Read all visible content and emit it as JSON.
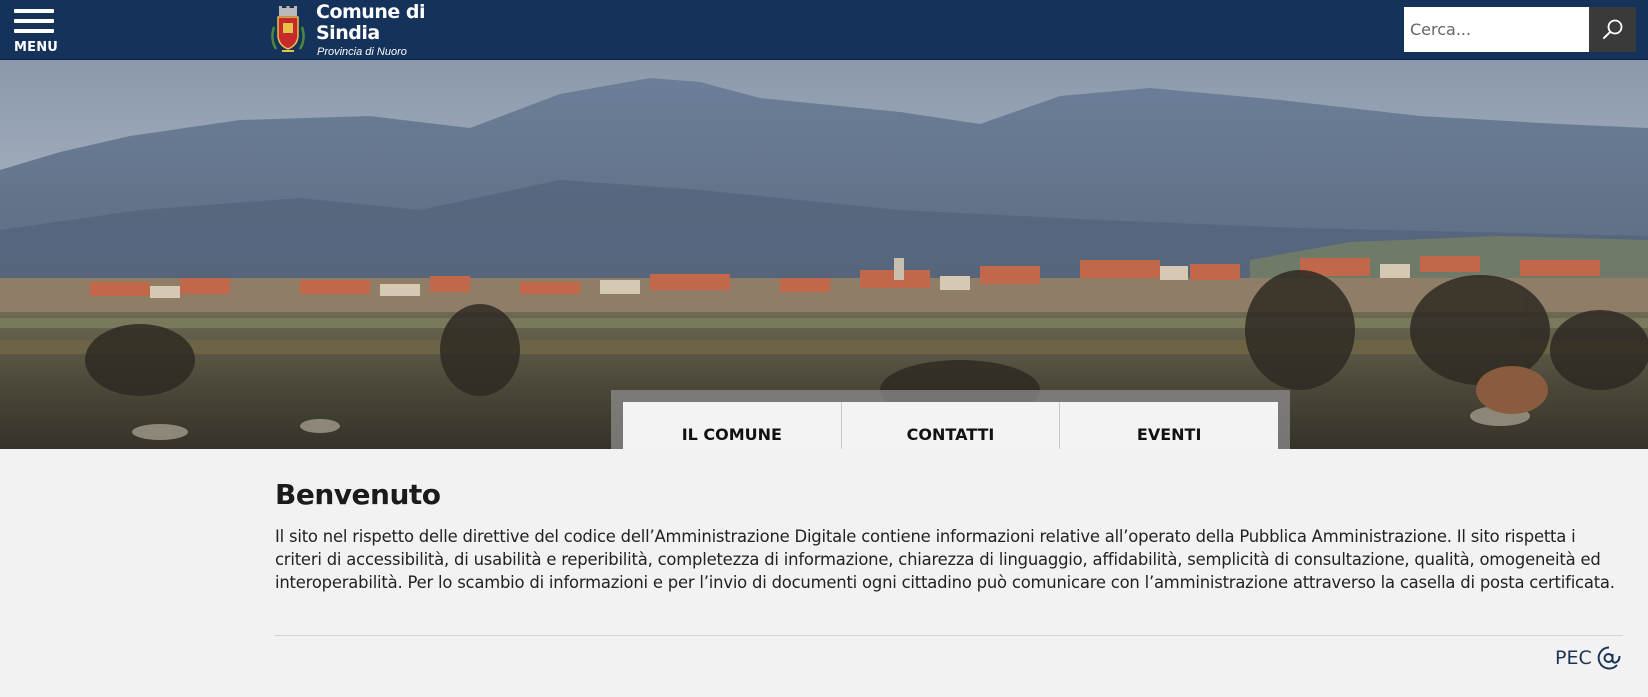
{
  "header": {
    "menu_label": "MENU",
    "site_title_line1": "Comune di",
    "site_title_line2": "Sindia",
    "site_subtitle": "Provincia di Nuoro",
    "search_placeholder": "Cerca...",
    "colors": {
      "background": "#14325a",
      "search_button": "#3a3a3a"
    }
  },
  "quick_links": [
    {
      "label": "IL COMUNE"
    },
    {
      "label": "CONTATTI"
    },
    {
      "label": "EVENTI"
    }
  ],
  "welcome": {
    "title": "Benvenuto",
    "body": "Il sito nel rispetto delle direttive del codice dell’Amministrazione Digitale contiene informazioni relative all’operato della Pubblica Amministrazione. Il sito rispetta i criteri di accessibilità, di usabilità e reperibilità, completezza di informazione, chiarezza di linguaggio, affidabilità, semplicità di consultazione, qualità, omogeneità ed interoperabilità. Per lo scambio di informazioni e per l’invio di documenti ogni cittadino può comunicare con l’amministrazione attraverso la casella di posta certificata."
  },
  "pec": {
    "label": "PEC",
    "icon": "at-sign-icon"
  },
  "icons": {
    "menu": "hamburger-icon",
    "search": "search-icon",
    "crest": "coat-of-arms-icon"
  }
}
